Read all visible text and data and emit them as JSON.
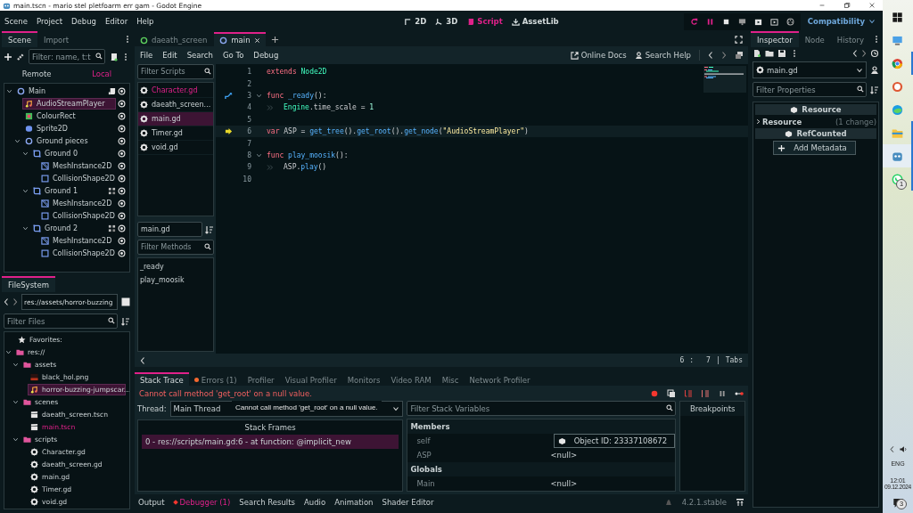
{
  "window": {
    "title": "main.tscn - mario stel pletfoarm err gam - Godot Engine"
  },
  "main_menu": [
    "Scene",
    "Project",
    "Debug",
    "Editor",
    "Help"
  ],
  "workspaces": [
    {
      "label": "2D",
      "kind": "plane",
      "selected": false
    },
    {
      "label": "3D",
      "kind": "space",
      "selected": false
    },
    {
      "label": "Script",
      "kind": "script",
      "selected": true
    },
    {
      "label": "AssetLib",
      "kind": "assetlib",
      "selected": false
    }
  ],
  "renderer": "Compatibility",
  "scene_dock": {
    "tabs": [
      {
        "label": "Scene",
        "selected": true
      },
      {
        "label": "Import",
        "selected": false
      }
    ],
    "filter": {
      "placeholder": "Filter: name, t:t"
    },
    "modes": [
      {
        "label": "Remote",
        "selected": false
      },
      {
        "label": "Local",
        "selected": true
      }
    ],
    "tree": [
      {
        "name": "Main",
        "kind": "node2d",
        "selected": false,
        "expanded": true,
        "script": true,
        "children": [
          {
            "name": "AudioStreamPlayer",
            "kind": "audio",
            "selected": true
          },
          {
            "name": "ColourRect",
            "kind": "colorrect",
            "selected": false
          },
          {
            "name": "Sprite2D",
            "kind": "sprite",
            "selected": false
          },
          {
            "name": "Ground pieces",
            "kind": "node2d",
            "selected": false,
            "expanded": true,
            "children": [
              {
                "name": "Ground 0",
                "kind": "body",
                "selected": false,
                "expanded": true,
                "children": [
                  {
                    "name": "MeshInstance2D",
                    "kind": "mesh",
                    "selected": false
                  },
                  {
                    "name": "CollisionShape2D",
                    "kind": "collision",
                    "selected": false
                  }
                ]
              },
              {
                "name": "Ground 1",
                "kind": "body",
                "selected": false,
                "expanded": true,
                "grouped": true,
                "children": [
                  {
                    "name": "MeshInstance2D",
                    "kind": "mesh",
                    "selected": false
                  },
                  {
                    "name": "CollisionShape2D",
                    "kind": "collision",
                    "selected": false
                  }
                ]
              },
              {
                "name": "Ground 2",
                "kind": "body",
                "selected": false,
                "expanded": true,
                "grouped": true,
                "children": [
                  {
                    "name": "MeshInstance2D",
                    "kind": "mesh",
                    "selected": false
                  },
                  {
                    "name": "CollisionShape2D",
                    "kind": "collision",
                    "selected": false
                  }
                ]
              }
            ]
          }
        ]
      }
    ]
  },
  "filesystem_dock": {
    "tabs": [
      {
        "label": "FileSystem",
        "selected": true
      }
    ],
    "path": "res://assets/horror-buzzing",
    "filter": {
      "placeholder": "Filter Files"
    },
    "favorites": "Favorites:",
    "tree": [
      {
        "name": "res://",
        "kind": "folder",
        "selected": false,
        "expanded": true,
        "children": [
          {
            "name": "assets",
            "kind": "folder",
            "selected": false,
            "expanded": true,
            "children": [
              {
                "name": "black_hol.png",
                "kind": "image",
                "selected": false,
                "open": false
              },
              {
                "name": "horror-buzzing-jumpscar...",
                "kind": "audio",
                "selected": true,
                "open": false
              }
            ]
          },
          {
            "name": "scenes",
            "kind": "folder",
            "selected": false,
            "expanded": true,
            "children": [
              {
                "name": "daeath_screen.tscn",
                "kind": "scene",
                "selected": false,
                "open": false
              },
              {
                "name": "main.tscn",
                "kind": "scene",
                "selected": false,
                "open": true
              }
            ]
          },
          {
            "name": "scripts",
            "kind": "folder",
            "selected": false,
            "expanded": true,
            "children": [
              {
                "name": "Character.gd",
                "kind": "script",
                "selected": false,
                "open": false
              },
              {
                "name": "daeath_screen.gd",
                "kind": "script",
                "selected": false,
                "open": false
              },
              {
                "name": "main.gd",
                "kind": "script",
                "selected": false,
                "open": false
              },
              {
                "name": "Timer.gd",
                "kind": "script",
                "selected": false,
                "open": false
              },
              {
                "name": "void.gd",
                "kind": "script",
                "selected": false,
                "open": false
              }
            ]
          }
        ]
      }
    ]
  },
  "script_tabs": [
    {
      "label": "daeath_screen",
      "selected": false
    },
    {
      "label": "main",
      "selected": true
    }
  ],
  "script_menu": [
    "File",
    "Edit",
    "Search",
    "Go To",
    "Debug"
  ],
  "help_links": [
    {
      "label": "Online Docs",
      "kind": "docs"
    },
    {
      "label": "Search Help",
      "kind": "help"
    }
  ],
  "script_list": {
    "filter": {
      "placeholder": "Filter Scripts"
    },
    "items": [
      {
        "name": "Character.gd",
        "selected": false,
        "accent": true
      },
      {
        "name": "daeath_screen....",
        "selected": false,
        "accent": false
      },
      {
        "name": "main.gd",
        "selected": true,
        "accent": false
      },
      {
        "name": "Timer.gd",
        "selected": false,
        "accent": false
      },
      {
        "name": "void.gd",
        "selected": false,
        "accent": false
      }
    ]
  },
  "method_panel": {
    "script_name": "main.gd",
    "filter": {
      "placeholder": "Filter Methods"
    },
    "methods": [
      "_ready",
      "play_moosik"
    ]
  },
  "code": {
    "lines": [
      {
        "number": "1",
        "current": false,
        "tokens": [
          {
            "text": "extends ",
            "kind": "keyword"
          },
          {
            "text": "Node2D",
            "kind": "type"
          }
        ]
      },
      {
        "number": "2",
        "current": false
      },
      {
        "number": "3",
        "current": false,
        "signal": true,
        "foldable": true,
        "tokens": [
          {
            "text": "func ",
            "kind": "keyword"
          },
          {
            "text": "_ready",
            "kind": "function"
          },
          {
            "text": "():",
            "kind": "plain"
          }
        ]
      },
      {
        "number": "4",
        "current": false,
        "tab": true,
        "tokens": [
          {
            "text": "Engine",
            "kind": "type"
          },
          {
            "text": ".time_scale = ",
            "kind": "plain"
          },
          {
            "text": "1",
            "kind": "number"
          }
        ]
      },
      {
        "number": "5",
        "current": false
      },
      {
        "number": "6",
        "current": true,
        "tokens": [
          {
            "text": "var",
            "kind": "keyword"
          },
          {
            "text": " ASP = ",
            "kind": "plain"
          },
          {
            "text": "get_tree",
            "kind": "function"
          },
          {
            "text": "().",
            "kind": "plain"
          },
          {
            "text": "get_root",
            "kind": "function"
          },
          {
            "text": "().",
            "kind": "plain"
          },
          {
            "text": "get_node",
            "kind": "function"
          },
          {
            "text": "(",
            "kind": "plain"
          },
          {
            "text": "\"AudioStreamPlayer\"",
            "kind": "string"
          },
          {
            "text": ")",
            "kind": "plain"
          }
        ]
      },
      {
        "number": "7",
        "current": false
      },
      {
        "number": "8",
        "current": false,
        "foldable": true,
        "tokens": [
          {
            "text": "func ",
            "kind": "keyword"
          },
          {
            "text": "play_moosik",
            "kind": "function"
          },
          {
            "text": "():",
            "kind": "plain"
          }
        ]
      },
      {
        "number": "9",
        "current": false,
        "tab": true,
        "tokens": [
          {
            "text": "ASP.",
            "kind": "plain"
          },
          {
            "text": "play",
            "kind": "function"
          },
          {
            "text": "()",
            "kind": "plain"
          }
        ]
      },
      {
        "number": "10",
        "current": false
      }
    ]
  },
  "status": {
    "line": "6",
    "separator": ":",
    "column": "7",
    "divider": "|",
    "indentation": "Tabs"
  },
  "debugger": {
    "tabs": [
      {
        "label": "Stack Trace",
        "selected": true,
        "alert": false
      },
      {
        "label": "Errors (1)",
        "selected": false,
        "alert": true
      },
      {
        "label": "Profiler",
        "selected": false,
        "alert": false
      },
      {
        "label": "Visual Profiler",
        "selected": false,
        "alert": false
      },
      {
        "label": "Monitors",
        "selected": false,
        "alert": false
      },
      {
        "label": "Video RAM",
        "selected": false,
        "alert": false
      },
      {
        "label": "Misc",
        "selected": false,
        "alert": false
      },
      {
        "label": "Network Profiler",
        "selected": false,
        "alert": false
      }
    ],
    "message": "Cannot call method 'get_root' on a null value.",
    "thread_label": "Thread:",
    "thread": "Main Thread",
    "tooltip": "Cannot call method 'get_root' on a null value.",
    "frames_title": "Stack Frames",
    "frames": [
      {
        "text": "0 - res://scripts/main.gd:6 - at function: @implicit_new",
        "selected": true
      }
    ],
    "variables_filter": {
      "placeholder": "Filter Stack Variables"
    },
    "sections": [
      {
        "title": "Members",
        "rows": [
          {
            "name": "self",
            "value": "Object ID: 23337108672",
            "kind": "object"
          },
          {
            "name": "ASP",
            "value": "<null>",
            "kind": "plain"
          }
        ]
      },
      {
        "title": "Globals",
        "rows": [
          {
            "name": "Main",
            "value": "<null>",
            "kind": "plain"
          }
        ]
      }
    ],
    "breakpoints_title": "Breakpoints"
  },
  "bottom_tabs": [
    {
      "label": "Output",
      "selected": false,
      "alert": false
    },
    {
      "label": "Debugger (1)",
      "selected": true,
      "alert": true
    },
    {
      "label": "Search Results",
      "selected": false,
      "alert": false
    },
    {
      "label": "Audio",
      "selected": false,
      "alert": false
    },
    {
      "label": "Animation",
      "selected": false,
      "alert": false
    },
    {
      "label": "Shader Editor",
      "selected": false,
      "alert": false
    }
  ],
  "version": "4.2.1.stable",
  "inspector": {
    "tabs": [
      {
        "label": "Inspector",
        "selected": true
      },
      {
        "label": "Node",
        "selected": false
      },
      {
        "label": "History",
        "selected": false
      }
    ],
    "resource": "main.gd",
    "filter": {
      "placeholder": "Filter Properties"
    },
    "rows": [
      {
        "kind": "category",
        "label": "Resource"
      },
      {
        "kind": "group",
        "label": "Resource",
        "note": "(1 change)"
      },
      {
        "kind": "category",
        "label": "RefCounted"
      },
      {
        "kind": "button",
        "label": "Add Metadata"
      }
    ]
  },
  "taskbar": {
    "apps": [
      {
        "kind": "windows",
        "running": false,
        "selected": false
      },
      {
        "kind": "computer",
        "running": false,
        "selected": false
      },
      {
        "kind": "chrome",
        "running": true,
        "selected": false
      },
      {
        "kind": "duck",
        "running": false,
        "selected": false
      },
      {
        "kind": "edge",
        "running": false,
        "selected": false
      },
      {
        "kind": "explorer",
        "running": true,
        "selected": false
      },
      {
        "kind": "godot",
        "running": true,
        "selected": true
      },
      {
        "kind": "whatsapp",
        "running": true,
        "selected": false,
        "badge": "1"
      }
    ],
    "language": "ENG",
    "time": "12:01",
    "date": "09.12.2024",
    "notifications": "3"
  }
}
